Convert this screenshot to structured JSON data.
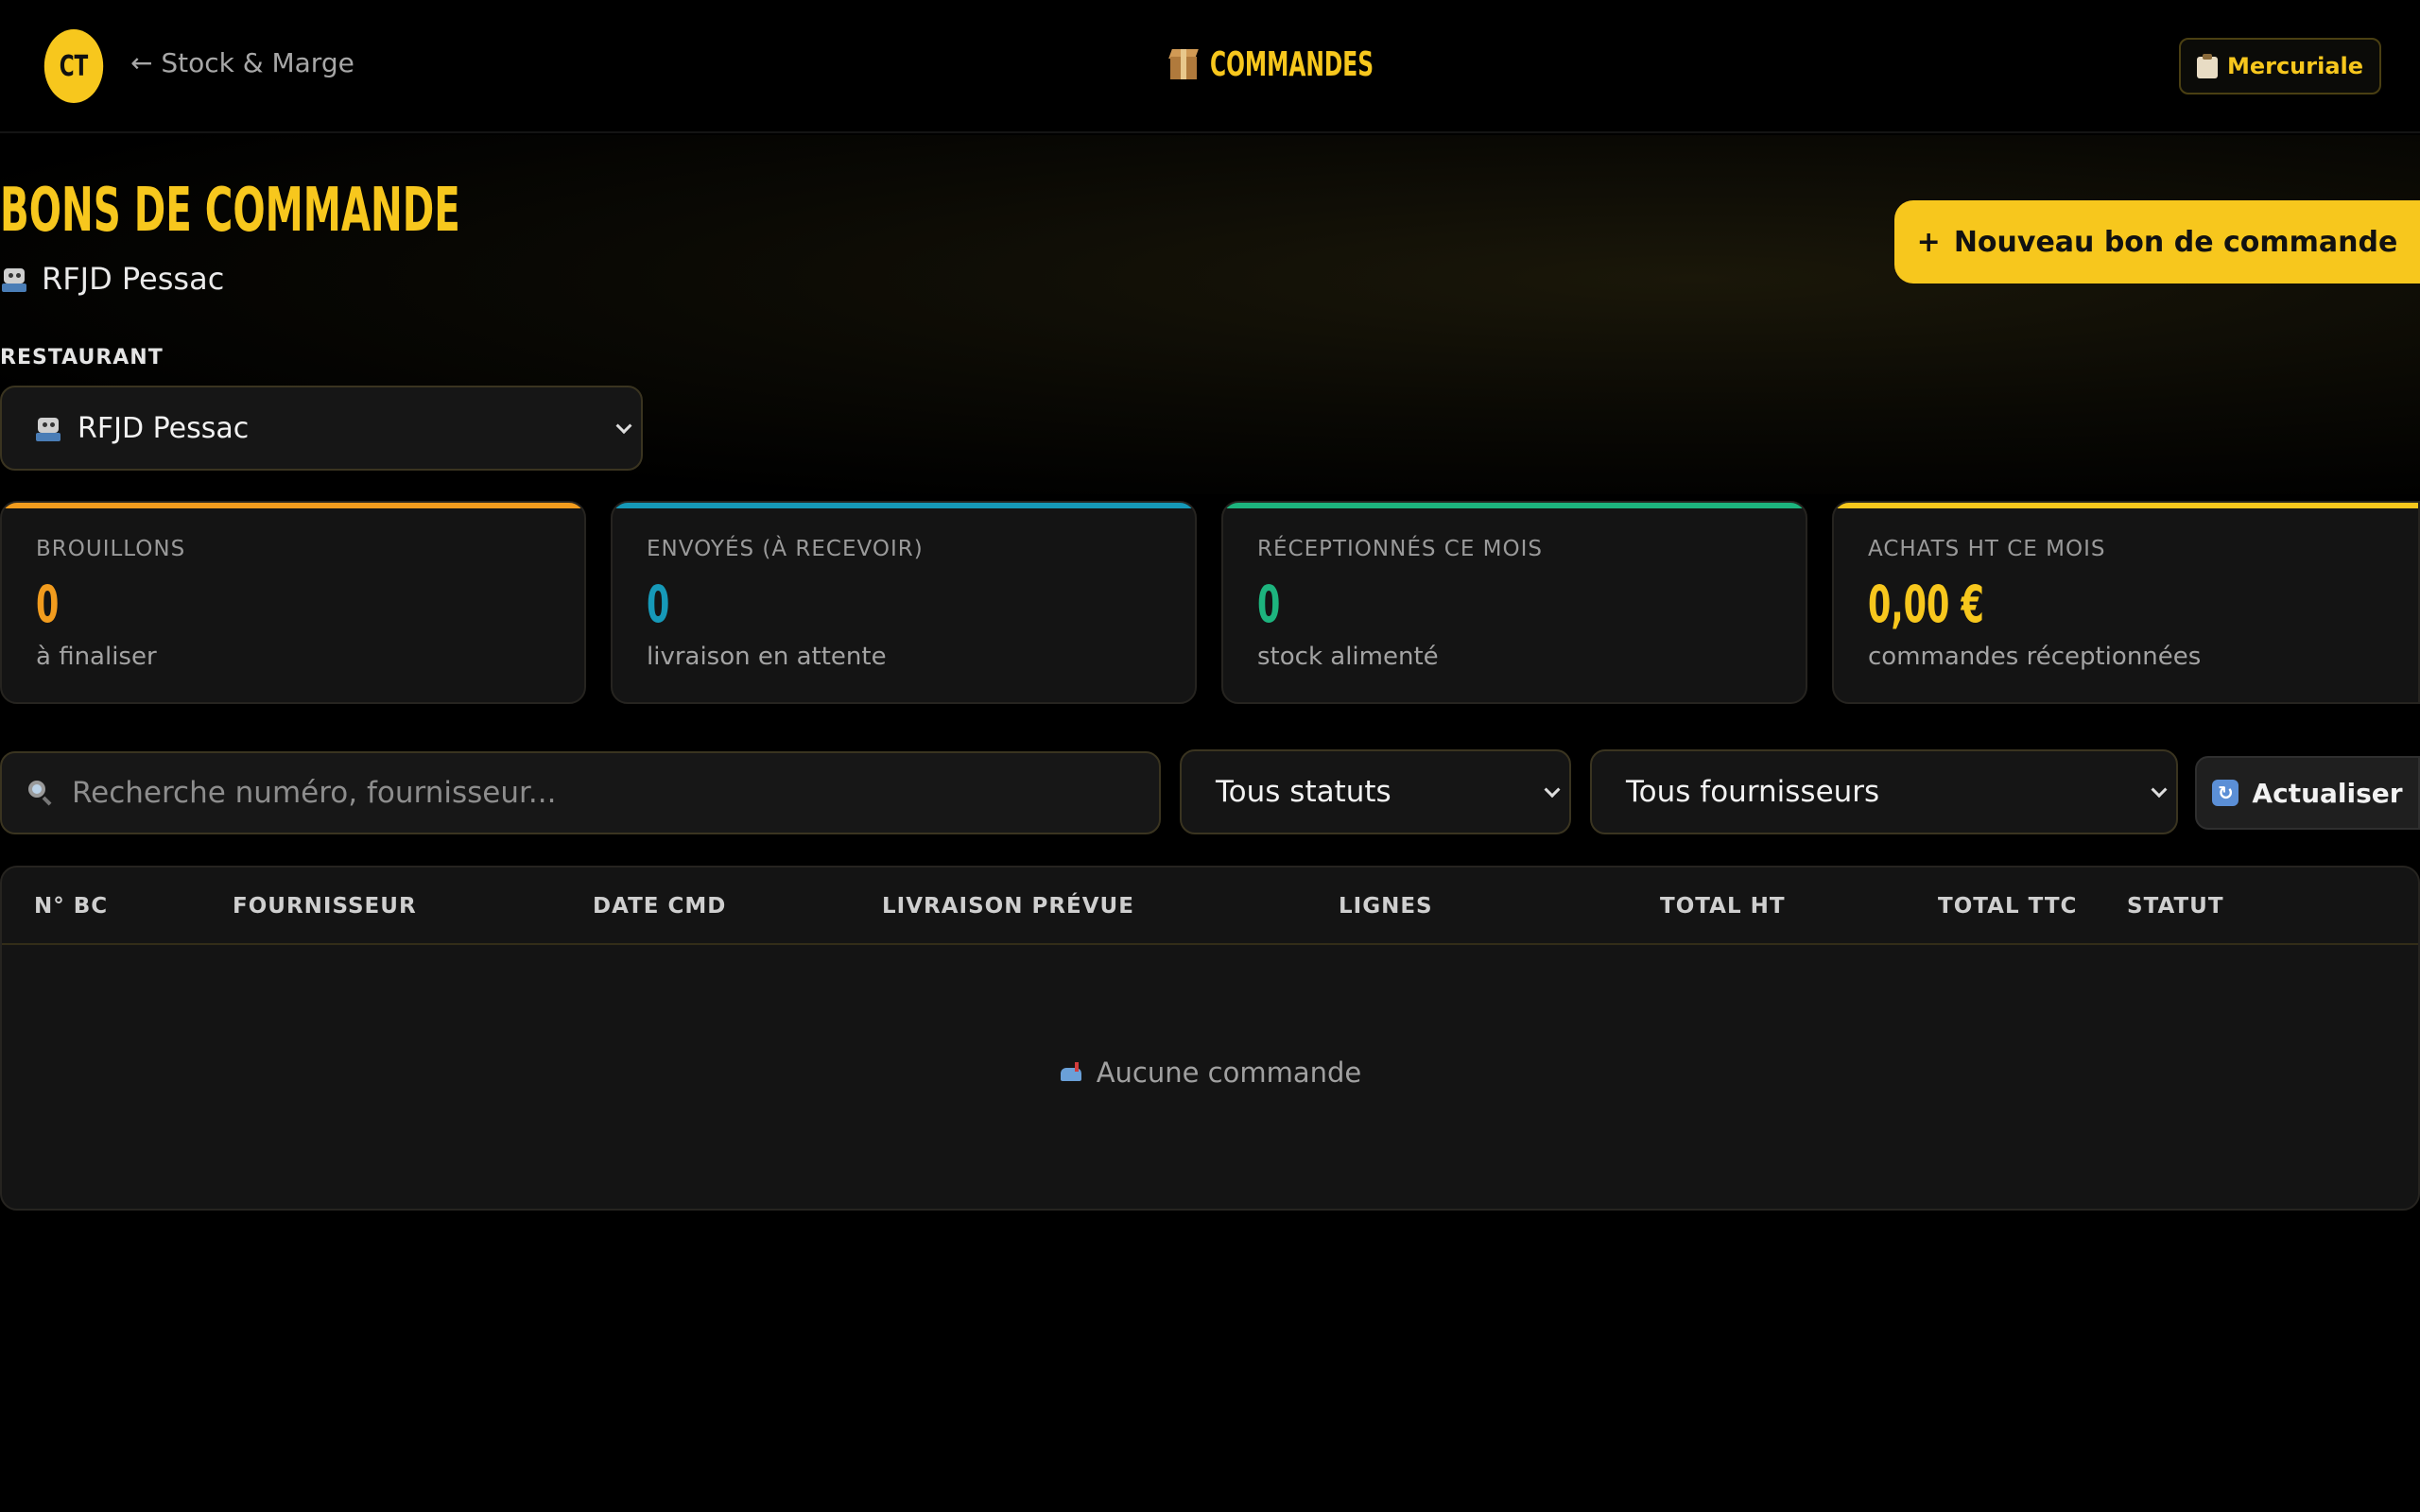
{
  "topbar": {
    "avatar": "CT",
    "back_label": "← Stock & Marge",
    "title": "COMMANDES",
    "mercuriale_label": "Mercuriale"
  },
  "header": {
    "page_title": "BONS DE COMMANDE",
    "restaurant_name": "RFJD Pessac",
    "new_order_label": "Nouveau bon de commande",
    "new_order_plus": "+"
  },
  "restaurant_filter": {
    "label": "RESTAURANT",
    "selected": "RFJD Pessac"
  },
  "cards": [
    {
      "title": "BROUILLONS",
      "value": "0",
      "sub": "à finaliser",
      "color": "#f29c1e"
    },
    {
      "title": "ENVOYÉS (À RECEVOIR)",
      "value": "0",
      "sub": "livraison en attente",
      "color": "#1699b8"
    },
    {
      "title": "RÉCEPTIONNÉS CE MOIS",
      "value": "0",
      "sub": "stock alimenté",
      "color": "#1db47e"
    },
    {
      "title": "ACHATS HT CE MOIS",
      "value": "0,00 €",
      "sub": "commandes réceptionnées",
      "color": "#f7c71d"
    }
  ],
  "filters": {
    "search_placeholder": "Recherche numéro, fournisseur...",
    "status_selected": "Tous statuts",
    "supplier_selected": "Tous fournisseurs",
    "refresh_label": "Actualiser"
  },
  "table": {
    "columns": [
      "N° BC",
      "FOURNISSEUR",
      "DATE CMD",
      "LIVRAISON PRÉVUE",
      "LIGNES",
      "TOTAL HT",
      "TOTAL TTC",
      "STATUT"
    ],
    "empty_message": "Aucune commande"
  },
  "colors": {
    "accent": "#f7c71d",
    "background": "#000000"
  }
}
